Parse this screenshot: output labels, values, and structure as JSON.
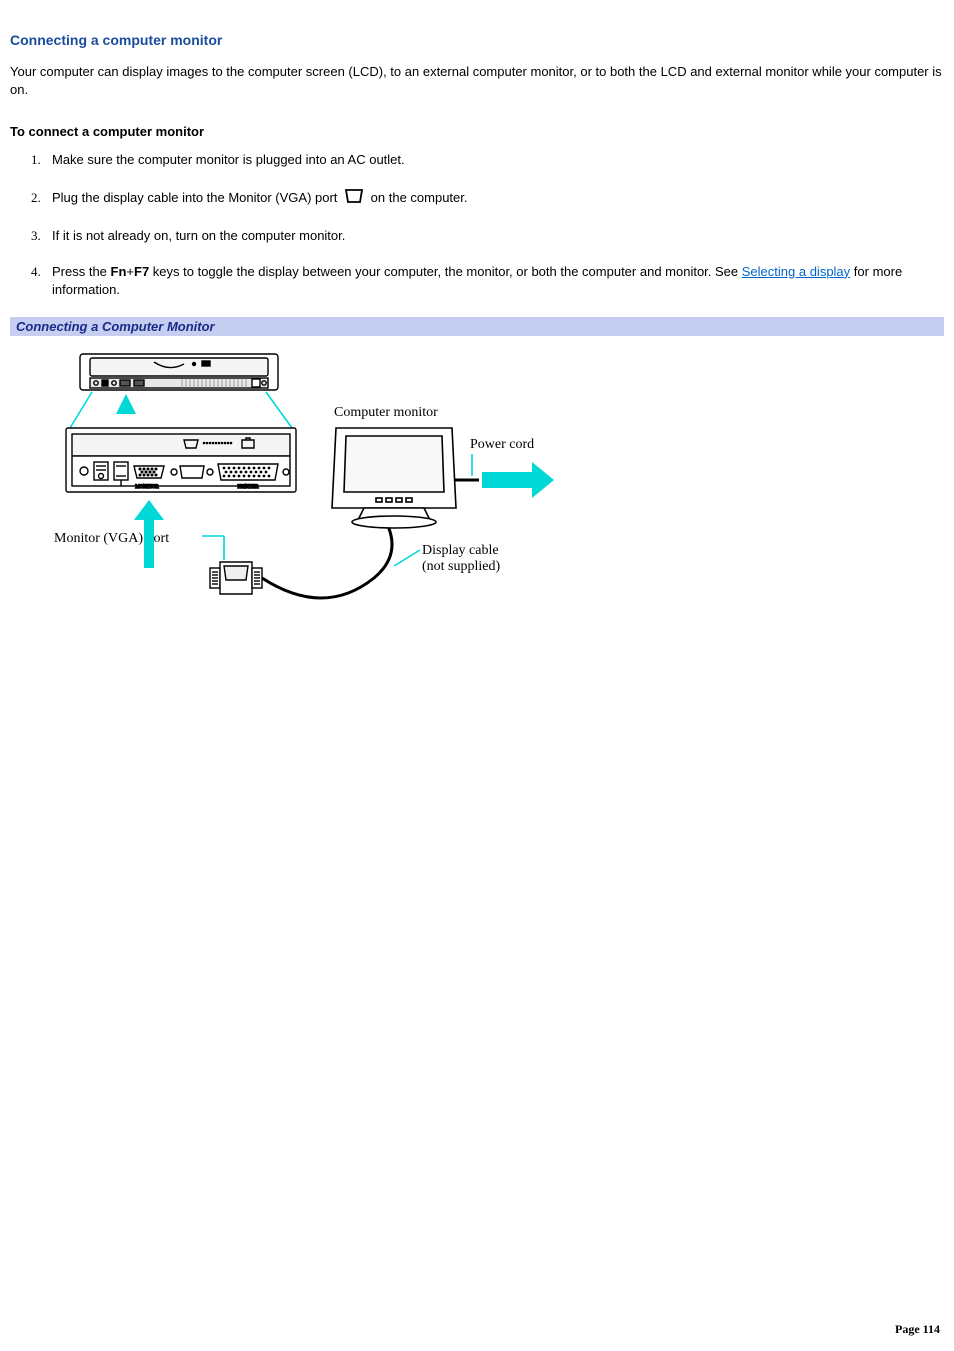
{
  "heading": "Connecting a computer monitor",
  "intro": "Your computer can display images to the computer screen (LCD), to an external computer monitor, or to both the LCD and external monitor while your computer is on.",
  "sub_heading": "To connect a computer monitor",
  "steps": {
    "s1": "Make sure the computer monitor is plugged into an AC outlet.",
    "s2a": "Plug the display cable into the Monitor (VGA) port ",
    "s2b": " on the computer.",
    "s3": "If it is not already on, turn on the computer monitor.",
    "s4a": "Press the ",
    "s4_key1": "Fn",
    "s4_plus": "+",
    "s4_key2": "F7",
    "s4b": " keys to toggle the display between your computer, the monitor, or both the computer and monitor. See ",
    "s4_link": "Selecting a display",
    "s4c": " for more information."
  },
  "caption": "Connecting a Computer Monitor",
  "fig": {
    "computer_monitor": "Computer monitor",
    "power_cord": "Power cord",
    "vga_port": "Monitor (VGA) port",
    "display_cable_l1": "Display cable",
    "display_cable_l2": "(not supplied)"
  },
  "footer": "Page 114"
}
